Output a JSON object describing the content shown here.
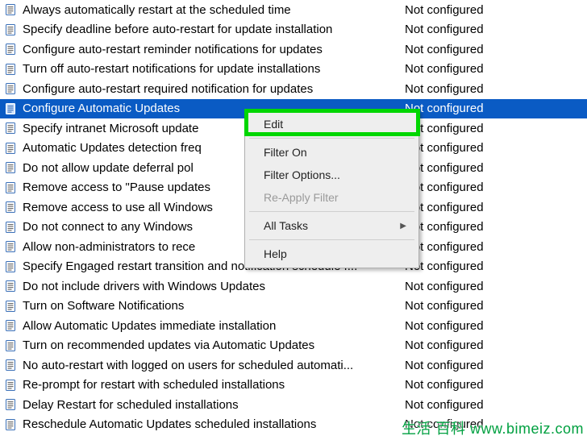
{
  "policies": [
    {
      "name": "Always automatically restart at the scheduled time",
      "state": "Not configured",
      "selected": false
    },
    {
      "name": "Specify deadline before auto-restart for update installation",
      "state": "Not configured",
      "selected": false
    },
    {
      "name": "Configure auto-restart reminder notifications for updates",
      "state": "Not configured",
      "selected": false
    },
    {
      "name": "Turn off auto-restart notifications for update installations",
      "state": "Not configured",
      "selected": false
    },
    {
      "name": "Configure auto-restart required notification for updates",
      "state": "Not configured",
      "selected": false
    },
    {
      "name": "Configure Automatic Updates",
      "state": "Not configured",
      "selected": true
    },
    {
      "name": "Specify intranet Microsoft update",
      "state": "Not configured",
      "selected": false
    },
    {
      "name": "Automatic Updates detection freq",
      "state": "Not configured",
      "selected": false
    },
    {
      "name": "Do not allow update deferral pol",
      "state": "Not configured",
      "selected": false
    },
    {
      "name": "Remove access to \"Pause updates",
      "state": "Not configured",
      "selected": false
    },
    {
      "name": "Remove access to use all Windows",
      "state": "Not configured",
      "selected": false
    },
    {
      "name": "Do not connect to any Windows",
      "state": "Not configured",
      "selected": false
    },
    {
      "name": "Allow non-administrators to rece",
      "state": "Not configured",
      "selected": false
    },
    {
      "name": "Specify Engaged restart transition and notification schedule f...",
      "state": "Not configured",
      "selected": false
    },
    {
      "name": "Do not include drivers with Windows Updates",
      "state": "Not configured",
      "selected": false
    },
    {
      "name": "Turn on Software Notifications",
      "state": "Not configured",
      "selected": false
    },
    {
      "name": "Allow Automatic Updates immediate installation",
      "state": "Not configured",
      "selected": false
    },
    {
      "name": "Turn on recommended updates via Automatic Updates",
      "state": "Not configured",
      "selected": false
    },
    {
      "name": "No auto-restart with logged on users for scheduled automati...",
      "state": "Not configured",
      "selected": false
    },
    {
      "name": "Re-prompt for restart with scheduled installations",
      "state": "Not configured",
      "selected": false
    },
    {
      "name": "Delay Restart for scheduled installations",
      "state": "Not configured",
      "selected": false
    },
    {
      "name": "Reschedule Automatic Updates scheduled installations",
      "state": "Not configured",
      "selected": false
    }
  ],
  "context_menu": {
    "edit": "Edit",
    "filter_on": "Filter On",
    "filter_options": "Filter Options...",
    "reapply_filter": "Re-Apply Filter",
    "all_tasks": "All Tasks",
    "help": "Help"
  },
  "watermark": {
    "cjk": "生活 百科",
    "url": "www.bimeiz.com"
  }
}
